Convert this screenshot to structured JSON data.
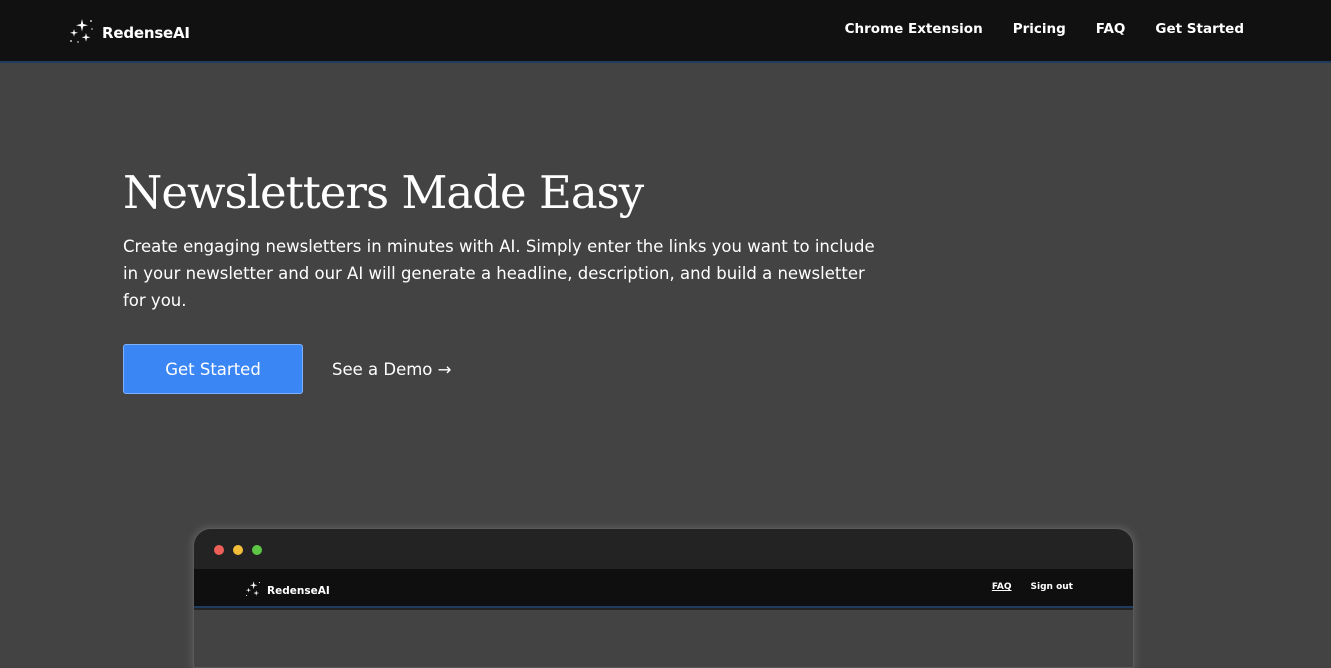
{
  "nav": {
    "brand": "RedenseAI",
    "links": [
      "Chrome Extension",
      "Pricing",
      "FAQ",
      "Get Started"
    ]
  },
  "hero": {
    "title": "Newsletters Made Easy",
    "description": "Create engaging newsletters in minutes with AI. Simply enter the links you want to include in your newsletter and our AI will generate a headline, description, and build a newsletter for you.",
    "primary_cta": "Get Started",
    "secondary_cta": "See a Demo →"
  },
  "demo": {
    "brand": "RedenseAI",
    "links": [
      "FAQ",
      "Sign out"
    ]
  },
  "colors": {
    "background": "#434343",
    "nav": "#111111",
    "accent": "#3b86f5"
  },
  "icons": {
    "logo": "sparkles-icon"
  }
}
